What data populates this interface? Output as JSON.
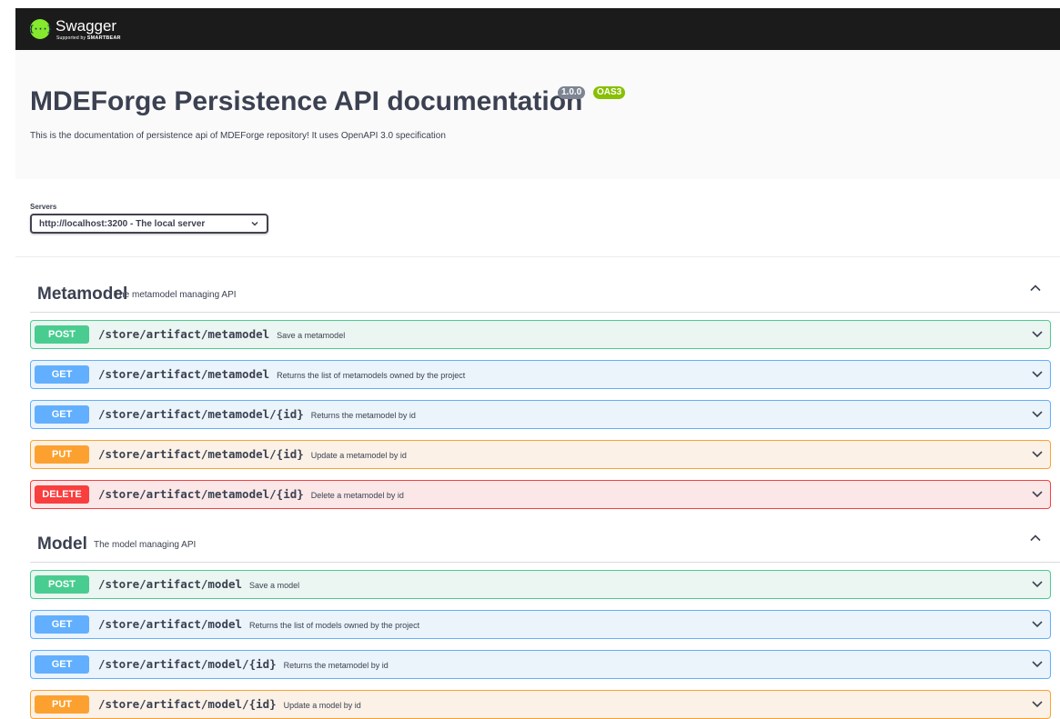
{
  "topbar": {
    "logo_glyph": "{···}",
    "brand": "Swagger",
    "supported_by": "Supported by",
    "supporter": "SMARTBEAR"
  },
  "info": {
    "title": "MDEForge Persistence API documentation",
    "version": "1.0.0",
    "oas": "OAS3",
    "description": "This is the documentation of persistence api of MDEForge repository! It uses OpenAPI 3.0 specification"
  },
  "servers": {
    "label": "Servers",
    "selected": "http://localhost:3200 - The local server"
  },
  "tags": [
    {
      "name": "Metamodel",
      "description": "The metamodel managing API",
      "operations": [
        {
          "method": "POST",
          "path": "/store/artifact/metamodel",
          "summary": "Save a metamodel"
        },
        {
          "method": "GET",
          "path": "/store/artifact/metamodel",
          "summary": "Returns the list of metamodels owned by the project"
        },
        {
          "method": "GET",
          "path": "/store/artifact/metamodel/{id}",
          "summary": "Returns the metamodel by id"
        },
        {
          "method": "PUT",
          "path": "/store/artifact/metamodel/{id}",
          "summary": "Update a metamodel by id"
        },
        {
          "method": "DELETE",
          "path": "/store/artifact/metamodel/{id}",
          "summary": "Delete a metamodel by id"
        }
      ]
    },
    {
      "name": "Model",
      "description": "The model managing API",
      "operations": [
        {
          "method": "POST",
          "path": "/store/artifact/model",
          "summary": "Save a model"
        },
        {
          "method": "GET",
          "path": "/store/artifact/model",
          "summary": "Returns the list of models owned by the project"
        },
        {
          "method": "GET",
          "path": "/store/artifact/model/{id}",
          "summary": "Returns the metamodel by id"
        },
        {
          "method": "PUT",
          "path": "/store/artifact/model/{id}",
          "summary": "Update a model by id"
        }
      ]
    }
  ],
  "icons": {
    "logo": "swagger-logo-icon",
    "select_chevron": "chevron-down-icon",
    "tag_toggle": "chevron-up-icon",
    "op_expand": "chevron-down-icon"
  },
  "colors": {
    "post": "#49cc90",
    "get": "#61affe",
    "put": "#fca130",
    "delete": "#f93e3e",
    "oas_badge": "#89bf04",
    "topbar": "#1b1b1b"
  }
}
